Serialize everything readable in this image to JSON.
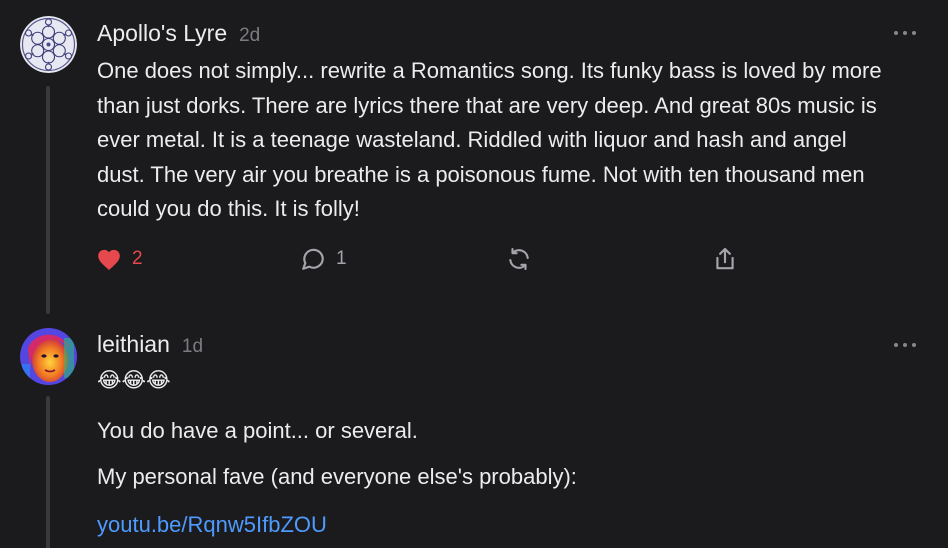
{
  "comments": [
    {
      "author": "Apollo's Lyre",
      "time": "2d",
      "avatar": "mandala-avatar",
      "text": "One does not simply... rewrite a Romantics song. Its funky bass is loved by more than just dorks. There are lyrics there that are very deep. And great 80s music is ever metal. It is a teenage wasteland. Riddled with liquor and hash and angel dust. The very air you breathe is a poisonous fume. Not with ten thousand men could you do this. It is folly!",
      "actions": {
        "likes": "2",
        "replies": "1"
      }
    },
    {
      "author": "leithian",
      "time": "1d",
      "avatar": "portrait-avatar",
      "emoji": "😂😂😂",
      "paragraphs": [
        "You do have a point... or several.",
        "My personal fave (and everyone else's probably):"
      ],
      "link": "youtu.be/Rqnw5IfbZOU"
    }
  ],
  "icons": {
    "like": "heart-icon",
    "reply": "speech-bubble-icon",
    "restack": "restack-icon",
    "share": "share-icon",
    "more": "more-options-icon"
  },
  "colors": {
    "background": "#1b1b1d",
    "text": "#ececee",
    "muted": "#7c7c82",
    "like": "#e5484d",
    "link": "#4d9bff"
  }
}
